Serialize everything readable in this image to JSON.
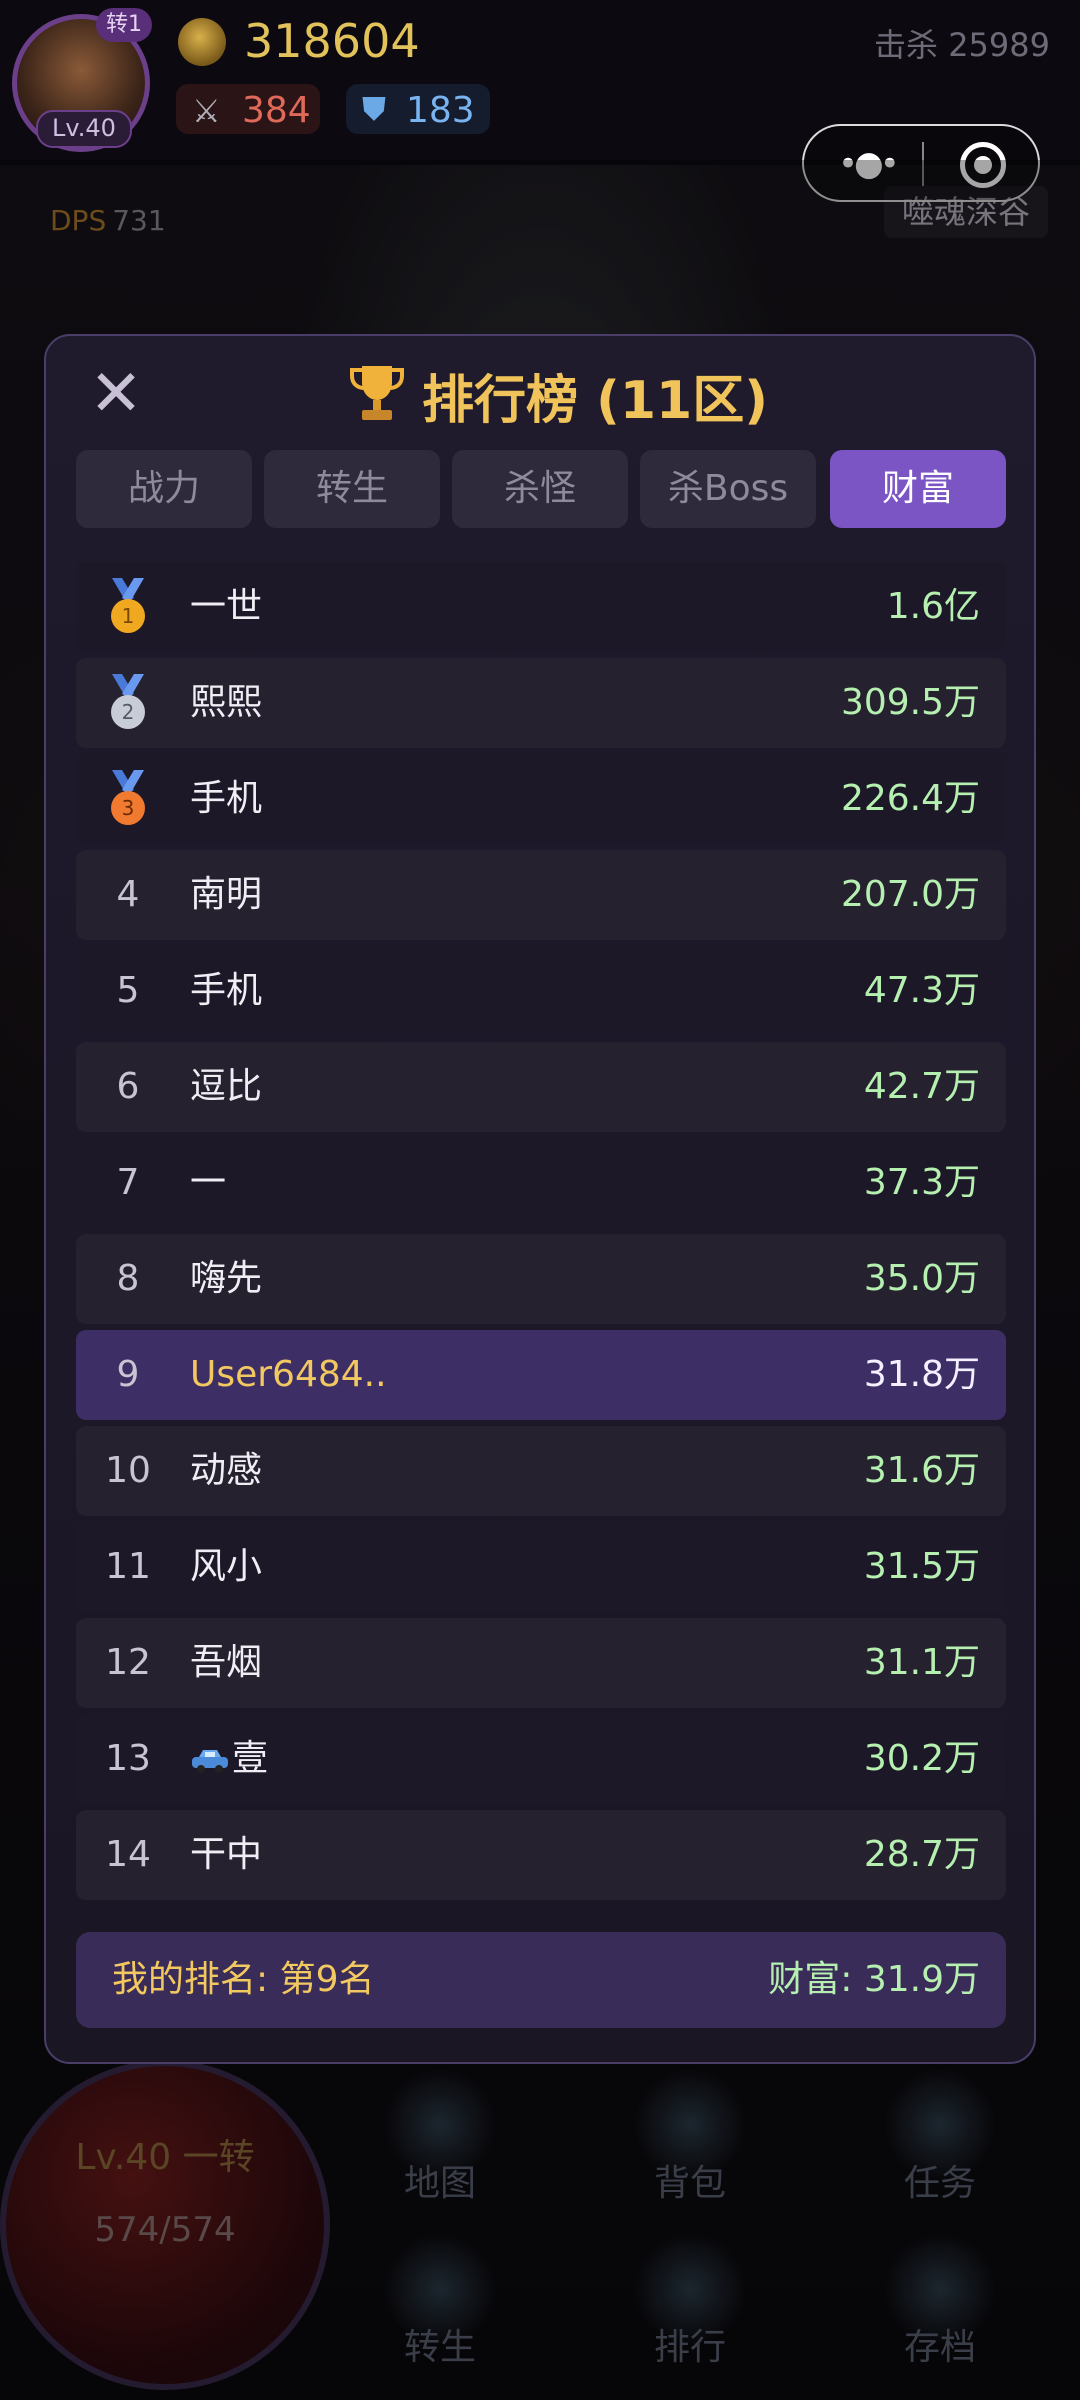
{
  "header": {
    "avatar_turn": "转1",
    "avatar_level": "Lv.40",
    "gold": "318604",
    "attack": "384",
    "defense": "183",
    "kills": "击杀 25989",
    "dps_label": "DPS",
    "dps_value": "731",
    "zone": "噬魂深谷"
  },
  "miniprogram": {
    "more_icon": "more-dots-icon",
    "close_icon": "target-close-icon"
  },
  "modal": {
    "title": "排行榜 (11区)",
    "close_icon": "close-x-icon",
    "tabs": [
      {
        "label": "战力",
        "active": false
      },
      {
        "label": "转生",
        "active": false
      },
      {
        "label": "杀怪",
        "active": false
      },
      {
        "label": "杀Boss",
        "active": false
      },
      {
        "label": "财富",
        "active": true
      }
    ],
    "rows": [
      {
        "rank": "1",
        "name": "一世",
        "value": "1.6亿"
      },
      {
        "rank": "2",
        "name": "熙熙",
        "value": "309.5万"
      },
      {
        "rank": "3",
        "name": "手机",
        "value": "226.4万"
      },
      {
        "rank": "4",
        "name": "南明",
        "value": "207.0万"
      },
      {
        "rank": "5",
        "name": "手机",
        "value": "47.3万"
      },
      {
        "rank": "6",
        "name": "逗比",
        "value": "42.7万"
      },
      {
        "rank": "7",
        "name": "一",
        "value": "37.3万"
      },
      {
        "rank": "8",
        "name": "嗨先",
        "value": "35.0万"
      },
      {
        "rank": "9",
        "name": "User6484..",
        "value": "31.8万"
      },
      {
        "rank": "10",
        "name": "动感",
        "value": "31.6万"
      },
      {
        "rank": "11",
        "name": "风小",
        "value": "31.5万"
      },
      {
        "rank": "12",
        "name": "吾烟",
        "value": "31.1万"
      },
      {
        "rank": "13",
        "name": "壹",
        "value": "30.2万"
      },
      {
        "rank": "14",
        "name": "干中",
        "value": "28.7万"
      }
    ],
    "my_rank": "我的排名: 第9名",
    "my_wealth": "财富: 31.9万"
  },
  "hud": {
    "level": "Lv.40 一转",
    "hp": "574/574",
    "nav": [
      {
        "label": "地图",
        "icon": "crossed-swords-icon"
      },
      {
        "label": "背包",
        "icon": "chest-icon"
      },
      {
        "label": "任务",
        "icon": "backpack-icon"
      },
      {
        "label": "转生",
        "icon": "phoenix-icon"
      },
      {
        "label": "排行",
        "icon": "trophy-statue-icon"
      },
      {
        "label": "存档",
        "icon": "rune-circle-icon"
      }
    ]
  },
  "colors": {
    "accent": "#7b55c4",
    "title_gold": "#f0c45a",
    "value_green": "#b6f0b0",
    "highlight_row": "#3e2e66"
  }
}
